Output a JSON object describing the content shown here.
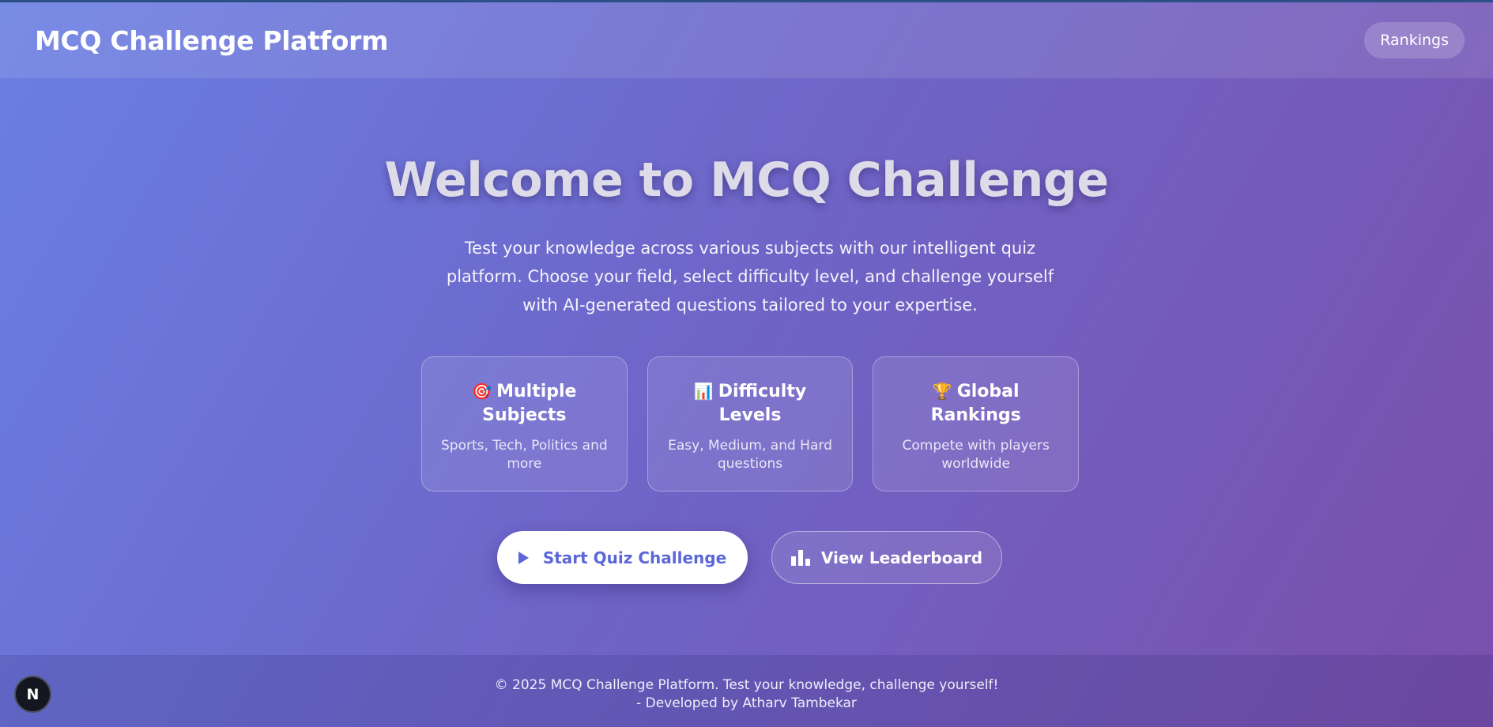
{
  "header": {
    "brand": "MCQ Challenge Platform",
    "rankings_label": "Rankings"
  },
  "hero": {
    "title": "Welcome to MCQ Challenge",
    "description": "Test your knowledge across various subjects with our intelligent quiz platform. Choose your field, select difficulty level, and challenge yourself with AI-generated questions tailored to your expertise."
  },
  "features": [
    {
      "icon": "🎯",
      "icon_name": "target-icon",
      "title": "Multiple Subjects",
      "desc": "Sports, Tech, Politics and more"
    },
    {
      "icon": "📊",
      "icon_name": "bar-chart-icon",
      "title": "Difficulty Levels",
      "desc": "Easy, Medium, and Hard questions"
    },
    {
      "icon": "🏆",
      "icon_name": "trophy-icon",
      "title": "Global Rankings",
      "desc": "Compete with players worldwide"
    }
  ],
  "actions": {
    "start_label": "Start Quiz Challenge",
    "leaderboard_label": "View Leaderboard"
  },
  "footer": {
    "line1": "© 2025 MCQ Challenge Platform. Test your knowledge, challenge yourself!",
    "line2": "- Developed by Atharv Tambekar"
  },
  "badge": {
    "letter": "N"
  },
  "colors": {
    "bg_start": "#6a7fe3",
    "bg_end": "#7a4fab",
    "primary_text": "#5b67d8"
  }
}
